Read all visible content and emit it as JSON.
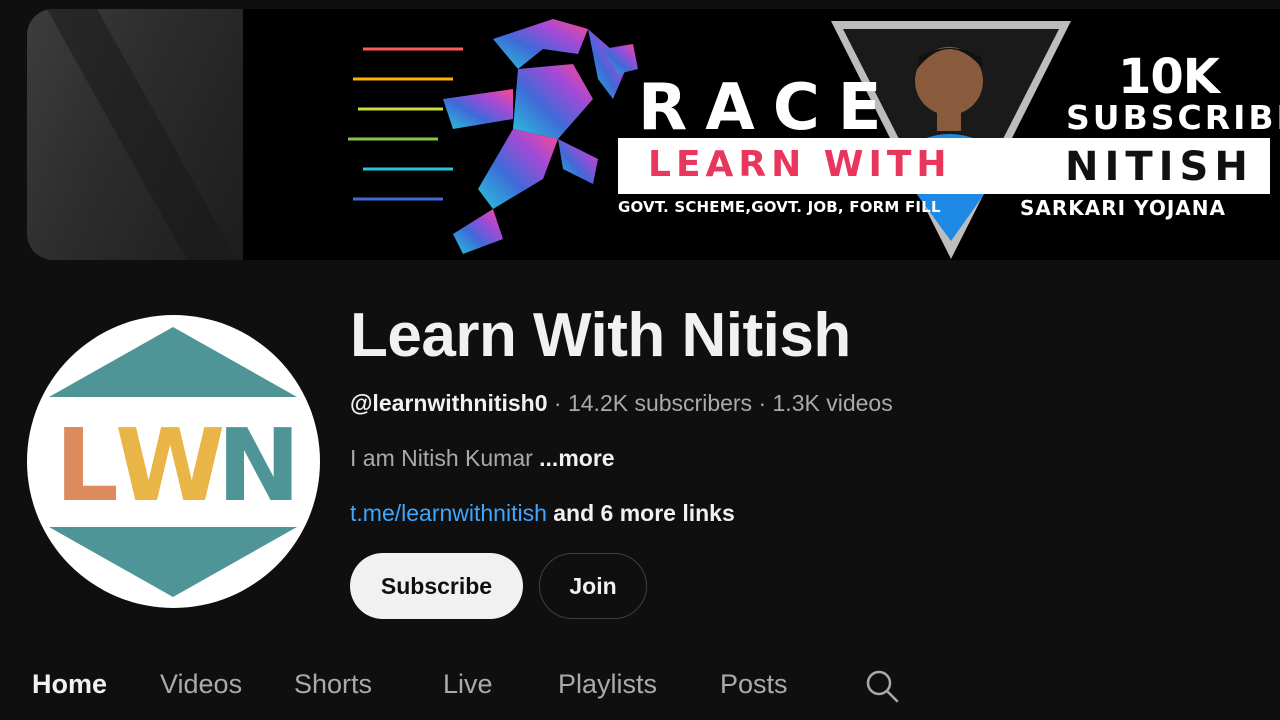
{
  "banner": {
    "race": "RACE",
    "learn_with": "LEARN WITH",
    "nitish": "NITISH",
    "govt_line": "GOVT. SCHEME,GOVT. JOB, FORM FILL",
    "sarkari": "SARKARI YOJANA",
    "ten_k": "10K",
    "subscriber": "SUBSCRIBER"
  },
  "avatar": {
    "letters": [
      "L",
      "W",
      "N"
    ],
    "colors": {
      "teal": "#4f9598",
      "orange": "#dd8a5e",
      "yellow": "#e9b546"
    }
  },
  "channel": {
    "name": "Learn With Nitish",
    "handle": "@learnwithnitish0",
    "subscribers": "14.2K subscribers",
    "videos": "1.3K videos",
    "separator": " · ",
    "description": "I am Nitish Kumar ",
    "more_label": "...more",
    "link": "t.me/learnwithnitish",
    "more_links": " and 6 more links"
  },
  "buttons": {
    "subscribe": "Subscribe",
    "join": "Join"
  },
  "tabs": [
    {
      "label": "Home",
      "active": true
    },
    {
      "label": "Videos",
      "active": false
    },
    {
      "label": "Shorts",
      "active": false
    },
    {
      "label": "Live",
      "active": false
    },
    {
      "label": "Playlists",
      "active": false
    },
    {
      "label": "Posts",
      "active": false
    }
  ],
  "icons": {
    "tab_search": "search-icon"
  },
  "colors": {
    "background": "#0f0f0f",
    "link": "#3ea6ff",
    "muted": "#aaaaaa",
    "text": "#f1f1f1"
  }
}
